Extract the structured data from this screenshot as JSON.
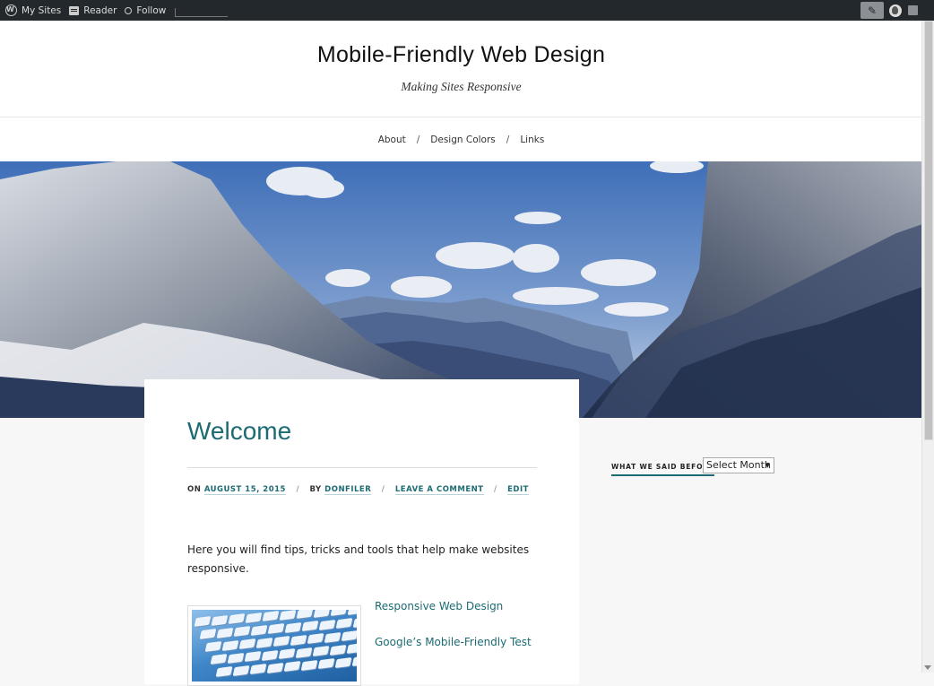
{
  "adminbar": {
    "my_sites": "My Sites",
    "reader": "Reader",
    "follow": "Follow"
  },
  "header": {
    "title": "Mobile-Friendly Web Design",
    "tagline": "Making Sites Responsive"
  },
  "nav": {
    "items": [
      "About",
      "Design Colors",
      "Links"
    ],
    "separator": "/"
  },
  "post": {
    "title": "Welcome",
    "meta": {
      "on_label": "ON",
      "date": "AUGUST 15, 2015",
      "by_label": "BY",
      "author": "DONFILER",
      "comment": "LEAVE A COMMENT",
      "edit": "EDIT"
    },
    "intro": "Here you will find tips, tricks and tools that help make websites responsive.",
    "links": [
      "Responsive Web Design",
      "Google’s Mobile-Friendly Test"
    ]
  },
  "sidebar": {
    "archive_title": "WHAT WE SAID BEFORE",
    "archive_select": "Select Month"
  },
  "colors": {
    "accent": "#1c6b73",
    "adminbar": "#23282d",
    "background": "#f7f7f7"
  }
}
